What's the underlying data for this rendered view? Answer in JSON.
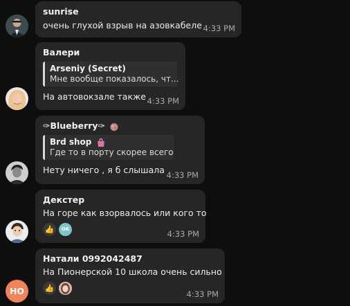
{
  "messages": [
    {
      "sender": "sunrise",
      "text": "очень глухой взрыв на азовкабеле",
      "time": "4:33 PM",
      "avatar": "photo-man-suit"
    },
    {
      "sender": "Валери",
      "reply": {
        "name": "Arseniy (Secret)",
        "text": "Мне вообще показалось, чт..."
      },
      "text": "На автовокзале также",
      "time": "4:33 PM",
      "avatar": "photo-woman-blonde"
    },
    {
      "sender": "✑Blueberry✑",
      "sender_icon": "blueberry-emoji-icon",
      "reply": {
        "name": "Brd shop",
        "name_icon": "shopping-bag-icon",
        "text": "Где то в порту скорее всего"
      },
      "text": "Нету ничего , я б слышала",
      "time": "4:33 PM",
      "avatar": "photo-man-bw"
    },
    {
      "sender": "Декстер",
      "text": "На горе как взорвалось или кого то",
      "time": "4:33 PM",
      "avatar": "photo-man-cartoon",
      "reactions": [
        "👍",
        "OK"
      ]
    },
    {
      "sender": "Натали 0992042487",
      "text": "На Пионерской 10 школа очень  сильно",
      "time": "4:33 PM",
      "avatar_initials": "НО",
      "avatar_color": "#f0855a",
      "reactions": [
        "👍",
        "face"
      ]
    }
  ]
}
